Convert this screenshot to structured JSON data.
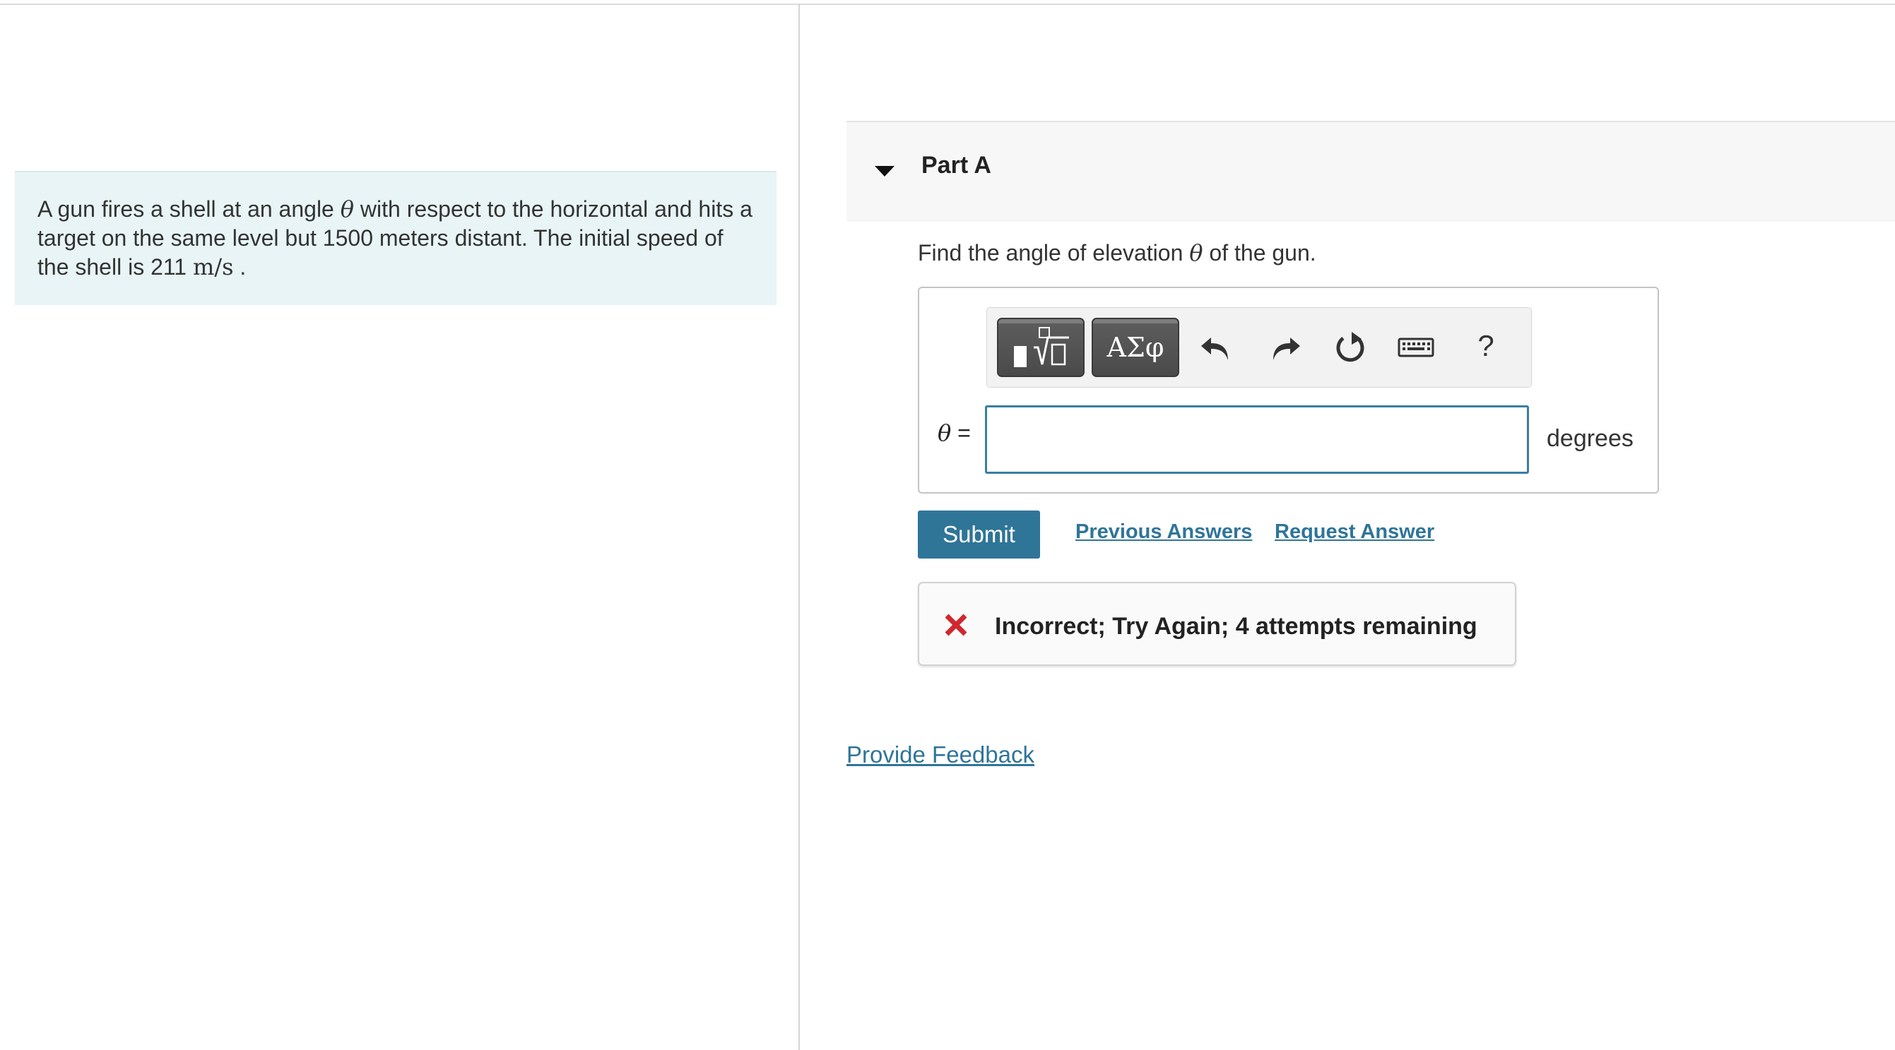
{
  "problem": {
    "text_before_theta": "A gun fires a shell at an angle ",
    "theta_symbol": "θ",
    "text_after_theta": " with respect to the horizontal and hits a target on the same level but 1500 meters distant. The initial speed of the shell is 211 ",
    "speed_unit": "m/s",
    "text_end": " ."
  },
  "part": {
    "title": "Part A",
    "toggle_icon": "caret-down-icon",
    "question_before": "Find the angle of elevation ",
    "question_symbol": "θ",
    "question_after": " of the gun."
  },
  "toolbar": {
    "templates_icon": "templates-icon",
    "symbols_label": "ΑΣφ",
    "undo_icon": "undo-icon",
    "redo_icon": "redo-icon",
    "reset_icon": "reset-icon",
    "keyboard_icon": "keyboard-icon",
    "help_label": "?"
  },
  "answer": {
    "variable": "θ",
    "equals": " =",
    "value": "",
    "unit": "degrees"
  },
  "actions": {
    "submit_label": "Submit",
    "previous_answers_label": "Previous Answers",
    "request_answer_label": "Request Answer"
  },
  "feedback": {
    "icon": "error-x-icon",
    "message": "Incorrect; Try Again; 4 attempts remaining",
    "icon_color": "#d0282e"
  },
  "footer": {
    "provide_feedback_label": "Provide Feedback"
  },
  "colors": {
    "accent": "#2f7598",
    "problem_background": "#e8f4f5",
    "input_border": "#3b7ea3"
  }
}
